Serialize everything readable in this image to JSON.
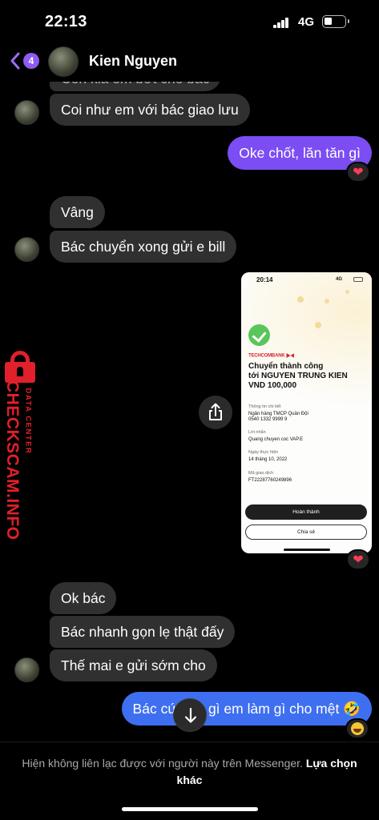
{
  "status": {
    "time": "22:13",
    "network": "4G"
  },
  "header": {
    "back_badge": "4",
    "contact_name": "Kien Nguyen"
  },
  "messages": {
    "m0": "Còn kia em bớt cho bác",
    "m1": "Coi như em với bác giao lưu",
    "m2": "Oke chốt, lăn tăn gì",
    "m3": "Vâng",
    "m4": "Bác chuyển xong gửi e bill",
    "m5": "Ok bác",
    "m6": "Bác nhanh gọn lẹ thật đấy",
    "m7": "Thế mai e gửi sớm cho",
    "m8": "Bác cứ bảo gì em làm gì cho mệt 🤣"
  },
  "colors": {
    "outgoing_bubble_1": "#7b4df2",
    "outgoing_bubble_2": "#3e6ff0",
    "incoming_bubble": "#303030",
    "accent": "#9b6cf5",
    "watermark": "#e0202a"
  },
  "receipt": {
    "time": "20:14",
    "network": "4G",
    "bank": "TECHCOMBANK",
    "title_1": "Chuyển thành công",
    "title_2": "tới NGUYEN TRUNG KIEN",
    "title_3": "VND 100,000",
    "details_label": "Thông tin chi tiết",
    "details_bank": "Ngân hàng TMCP Quân Đội",
    "details_account": "0540 1332 9999 9",
    "note_label": "Lời nhắn",
    "note_value": "Quang chuyen coc VAP.E",
    "date_label": "Ngày thực hiện",
    "date_value": "14 tháng 10, 2022",
    "txn_label": "Mã giao dịch",
    "txn_value": "FT22287760249896",
    "done_button": "Hoàn thành",
    "share_button": "Chia sẻ"
  },
  "watermark": {
    "site": "CHECKSCAM.INFO",
    "sub": "DATA CENTER"
  },
  "footer": {
    "notice": "Hiện không liên lạc được với người này trên Messenger.",
    "link": "Lựa chọn khác"
  },
  "icons": {
    "back": "chevron-left-icon",
    "share": "share-icon",
    "scroll": "arrow-down-icon",
    "reaction_heart": "heart-icon",
    "reaction_laugh": "laughing-icon"
  }
}
